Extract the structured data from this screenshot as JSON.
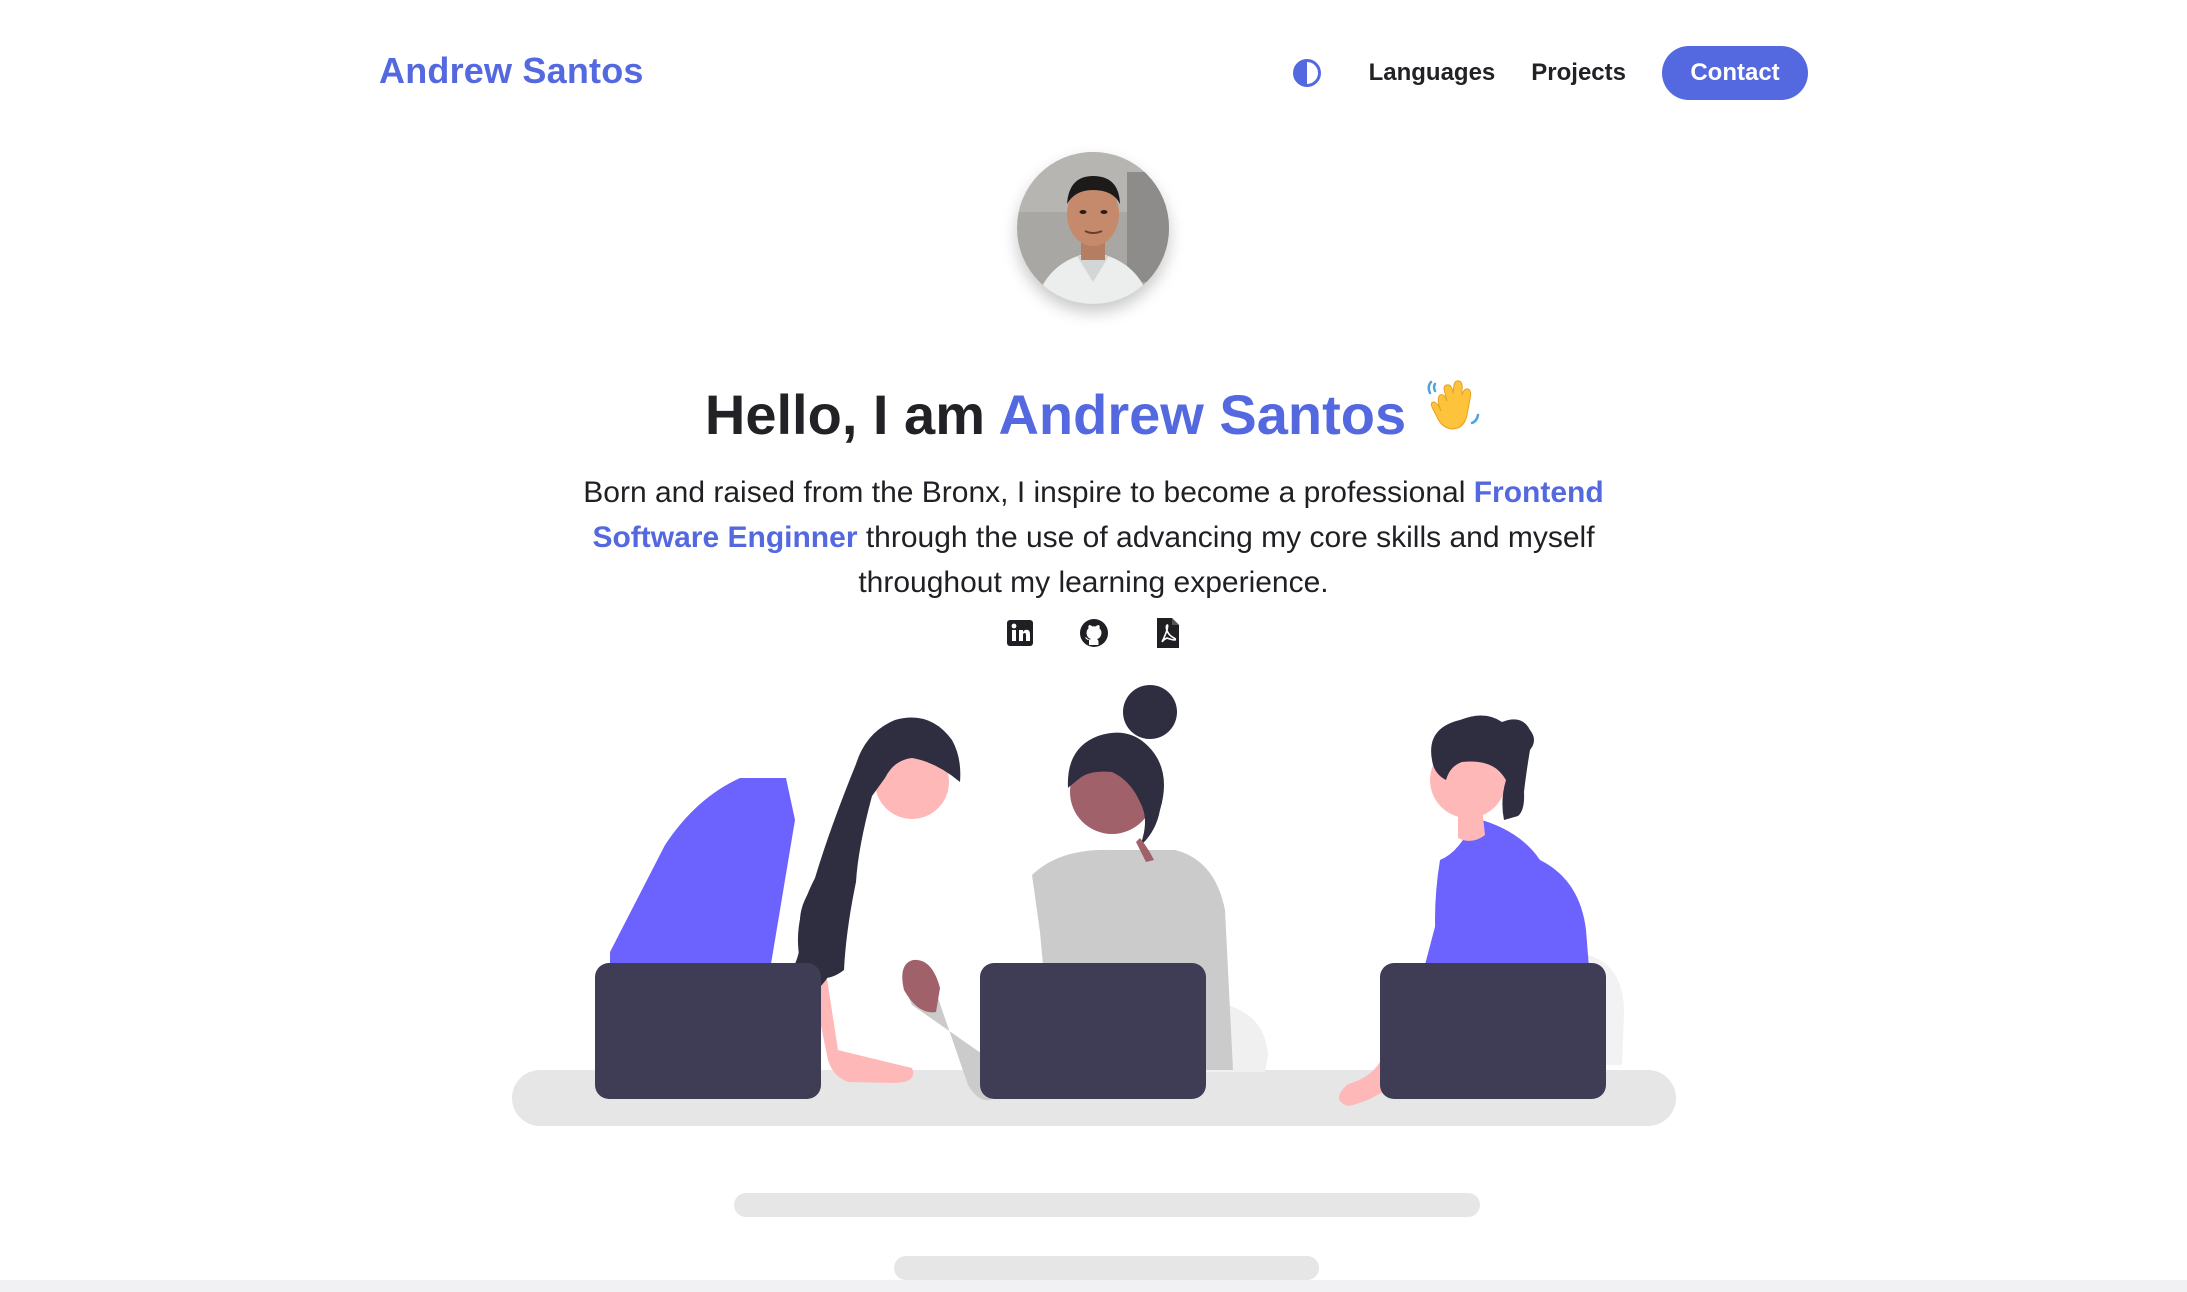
{
  "brand": {
    "name": "Andrew Santos",
    "accent_color": "#5468e0"
  },
  "nav": {
    "theme_toggle_icon": "half-circle-icon",
    "links": [
      "Languages",
      "Projects"
    ],
    "contact_label": "Contact"
  },
  "hero": {
    "avatar_alt": "profile-photo",
    "greeting_prefix": "Hello, I am ",
    "greeting_name": "Andrew Santos",
    "greeting_emoji": "waving-hand-icon",
    "bio_part1": "Born and raised from the Bronx, I inspire to become a professional ",
    "bio_highlight": "Frontend Software Enginner",
    "bio_part2": " through the use of advancing my core skills and myself throughout my learning experience."
  },
  "socials": [
    {
      "icon": "linkedin-icon"
    },
    {
      "icon": "github-icon"
    },
    {
      "icon": "pdf-resume-icon"
    }
  ],
  "illustration": {
    "colors": {
      "purple": "#6c63ff",
      "dark": "#3f3d56",
      "hair": "#2f2e41",
      "skin": "#ffb8b8",
      "skin_dark": "#a0616a",
      "gray": "#cbcbcb",
      "table": "#e6e6e6"
    }
  }
}
